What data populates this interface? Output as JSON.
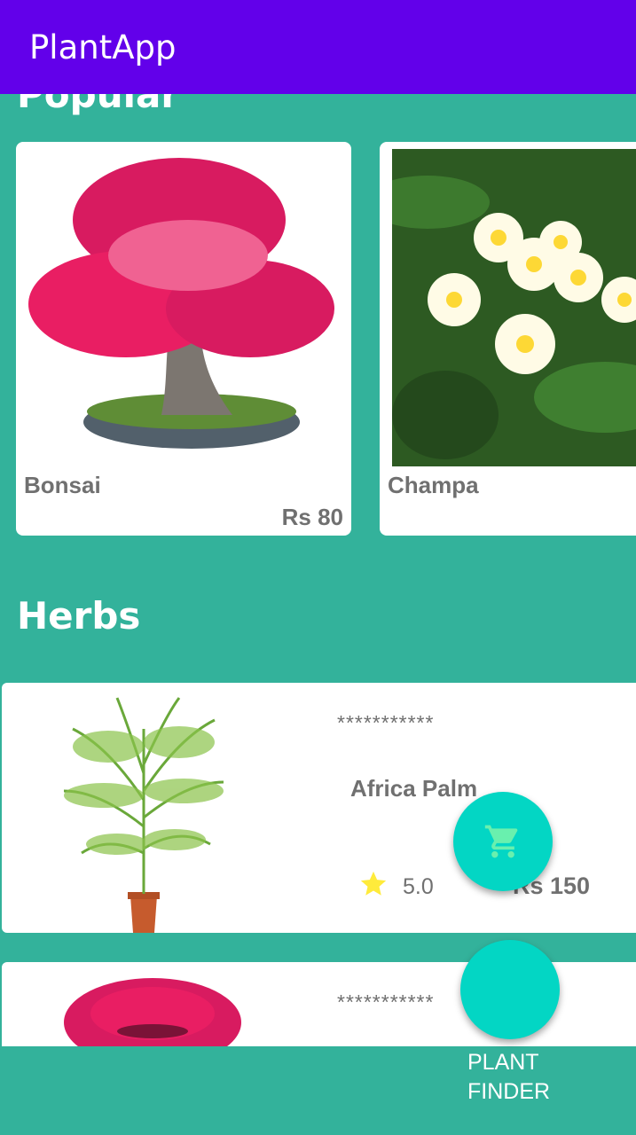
{
  "appbar": {
    "title": "PlantApp"
  },
  "sections": {
    "popular": "Popular",
    "herbs": "Herbs"
  },
  "popular": [
    {
      "name": "Bonsai",
      "price": "Rs 80"
    },
    {
      "name": "Champa",
      "price": ""
    }
  ],
  "herbs": [
    {
      "stars": "***********",
      "name": "Africa Palm",
      "rating": "5.0",
      "price": "Rs 150"
    },
    {
      "stars": "***********",
      "name": "",
      "rating": "",
      "price": ""
    }
  ],
  "fab": {
    "finder_label_line1": "PLANT",
    "finder_label_line2": "FINDER"
  },
  "icons": {
    "cart": "shopping-cart-icon",
    "rating": "star-icon"
  },
  "colors": {
    "appbar": "#6200ea",
    "background": "#33b29b",
    "fab": "#03d6c4",
    "cart_icon": "#69f0ae",
    "star": "#ffeb3b"
  }
}
